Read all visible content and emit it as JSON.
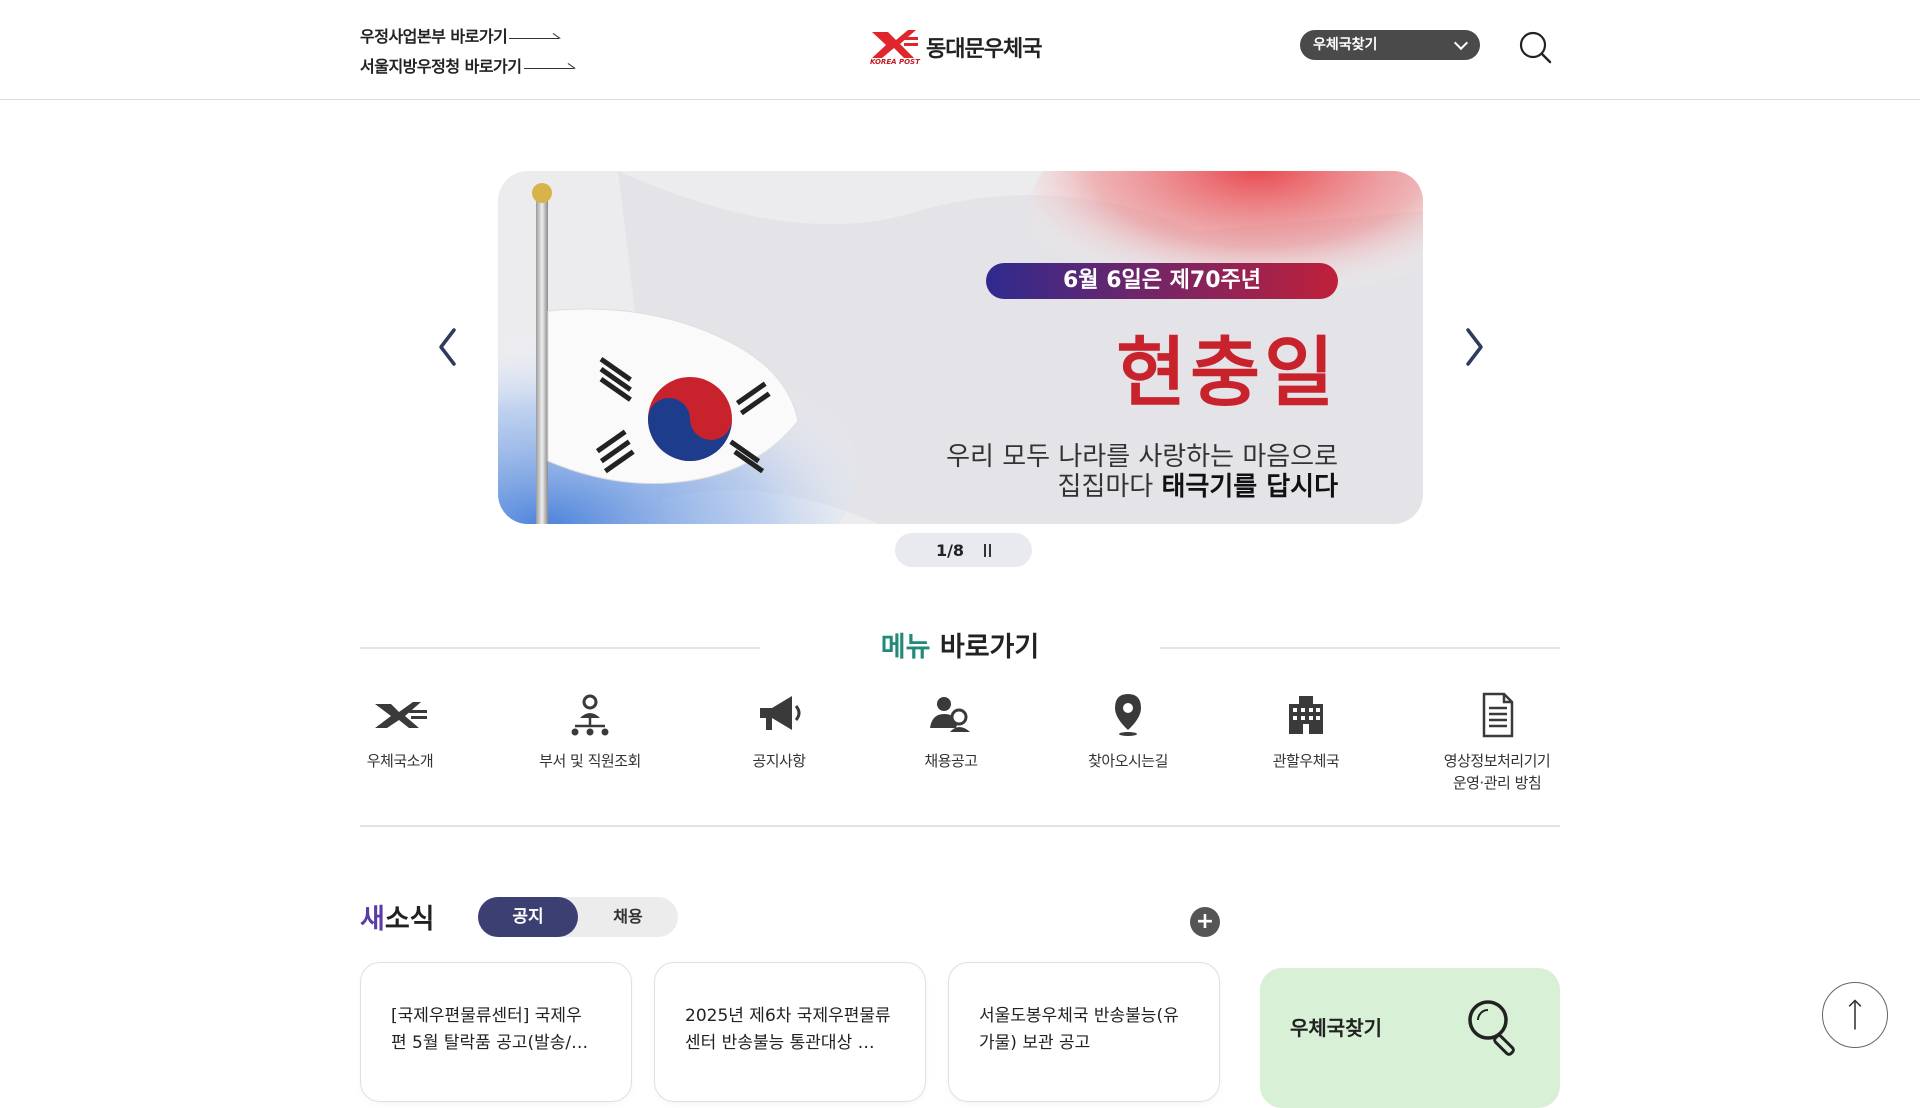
{
  "header": {
    "quick_links": [
      "우정사업본부 바로가기",
      "서울지방우정청 바로가기"
    ],
    "logo_title": "동대문우체국",
    "logo_sub": "KOREA POST",
    "office_select": "우체국찾기",
    "search_icon": "search-icon"
  },
  "banner": {
    "badge": "6월 6일은 제70주년",
    "headline": "현충일",
    "line1": "우리 모두 나라를 사랑하는 마음으로",
    "line2_pre": "집집마다",
    "line2_bold": "태극기를 답시다",
    "prev_icon": "chevron-left-icon",
    "next_icon": "chevron-right-icon",
    "pager": "1/8"
  },
  "menu": {
    "heading_accent": "메뉴",
    "heading_rest": "바로가기",
    "items": [
      {
        "label": "우체국소개",
        "icon": "korea-post-icon"
      },
      {
        "label": "부서 및 직원조회",
        "icon": "org-chart-icon"
      },
      {
        "label": "공지사항",
        "icon": "megaphone-icon"
      },
      {
        "label": "채용공고",
        "icon": "recruit-icon"
      },
      {
        "label": "찾아오시는길",
        "icon": "location-pin-icon"
      },
      {
        "label": "관할우체국",
        "icon": "building-icon"
      },
      {
        "label": "영상정보처리기기",
        "label2": "운영·관리 방침",
        "icon": "document-icon"
      }
    ]
  },
  "news": {
    "title_accent": "새",
    "title_rest": "소식",
    "tabs": [
      "공지",
      "채용"
    ],
    "more": "+",
    "cards": [
      {
        "line1": "[국제우편물류센터] 국제우",
        "line2": "편 5월 탈락품 공고(발송/…"
      },
      {
        "line1": "2025년 제6차 국제우편물류",
        "line2": "센터 반송불능 통관대상 …"
      },
      {
        "line1": "서울도봉우체국 반송불능(유",
        "line2": "가물) 보관 공고"
      }
    ],
    "find_label": "우체국찾기"
  },
  "colors": {
    "accent_green": "#218a78",
    "accent_purple": "#5b3aa6",
    "tab_active": "#3b3f72",
    "find_card": "#d7f0d6"
  }
}
